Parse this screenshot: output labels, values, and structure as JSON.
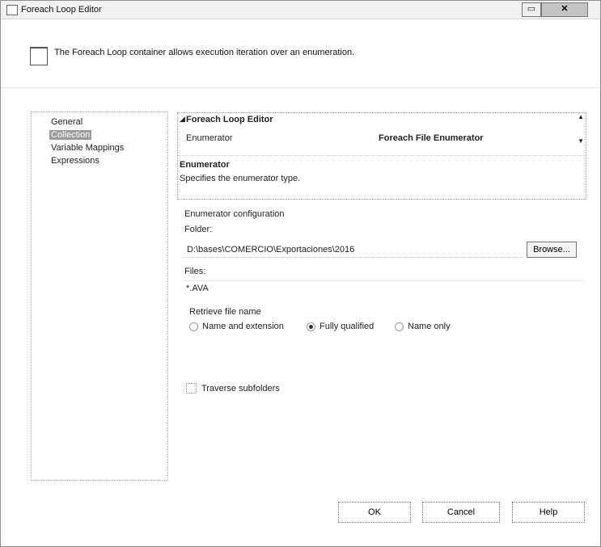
{
  "window": {
    "title": "Foreach Loop Editor"
  },
  "header": {
    "text": "The Foreach Loop container allows execution iteration over an enumeration."
  },
  "nav": {
    "items": [
      {
        "label": "General",
        "selected": false
      },
      {
        "label": "Collection",
        "selected": true
      },
      {
        "label": "Variable Mappings",
        "selected": false
      },
      {
        "label": "Expressions",
        "selected": false
      }
    ]
  },
  "property_grid": {
    "category": "Foreach Loop Editor",
    "property_name": "Enumerator",
    "property_value": "Foreach File Enumerator",
    "description_title": "Enumerator",
    "description_text": "Specifies the enumerator type."
  },
  "enumerator_config": {
    "title": "Enumerator configuration",
    "folder_label": "Folder:",
    "folder_value": "D:\\bases\\COMERCIO\\Exportaciones\\2016",
    "browse_label": "Browse...",
    "files_label": "Files:",
    "files_value": "*.AVA",
    "retrieve_title": "Retrieve file name",
    "options": [
      {
        "label": "Name and extension",
        "selected": false
      },
      {
        "label": "Fully qualified",
        "selected": true
      },
      {
        "label": "Name only",
        "selected": false
      }
    ],
    "traverse_label": "Traverse subfolders",
    "traverse_checked": false
  },
  "footer": {
    "ok": "OK",
    "cancel": "Cancel",
    "help": "Help"
  }
}
